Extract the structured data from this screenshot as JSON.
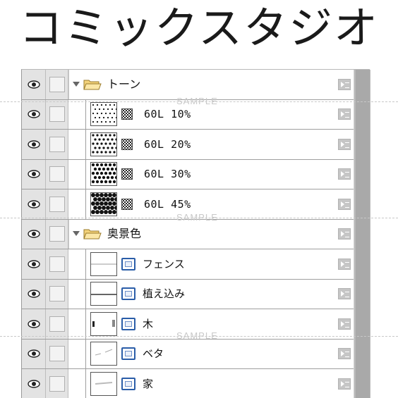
{
  "header": {
    "title": "コミックスタジオ"
  },
  "watermark": {
    "text": "SAMPLE"
  },
  "layers": [
    {
      "type": "folder",
      "name": "トーン",
      "icon": "folder-open-icon"
    },
    {
      "type": "tone",
      "name": "60L 10%",
      "density": 0.1
    },
    {
      "type": "tone",
      "name": "60L 20%",
      "density": 0.2
    },
    {
      "type": "tone",
      "name": "60L 30%",
      "density": 0.3
    },
    {
      "type": "tone",
      "name": "60L 45%",
      "density": 0.45
    },
    {
      "type": "folder",
      "name": "奥景色",
      "icon": "folder-open-icon"
    },
    {
      "type": "raster",
      "name": "フェンス"
    },
    {
      "type": "raster",
      "name": "植え込み"
    },
    {
      "type": "raster",
      "name": "木"
    },
    {
      "type": "raster",
      "name": "ベタ"
    },
    {
      "type": "raster",
      "name": "家"
    }
  ],
  "colors": {
    "raster_icon": "#2a5da8",
    "panel_bg": "#e9e9e9",
    "scrollbar": "#b9b9b9"
  }
}
